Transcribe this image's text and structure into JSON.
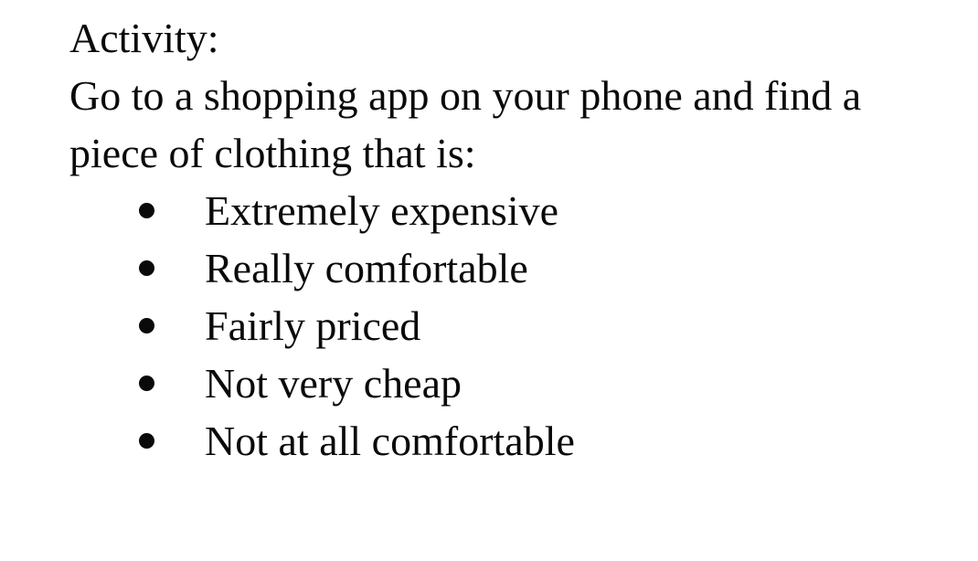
{
  "document": {
    "heading": "Activity:",
    "instruction_lines": [
      "Go to a shopping app on your phone and find a",
      "piece of clothing that is:"
    ],
    "items": [
      "Extremely expensive",
      "Really comfortable",
      "Fairly priced",
      "Not very cheap",
      "Not at all comfortable"
    ]
  }
}
